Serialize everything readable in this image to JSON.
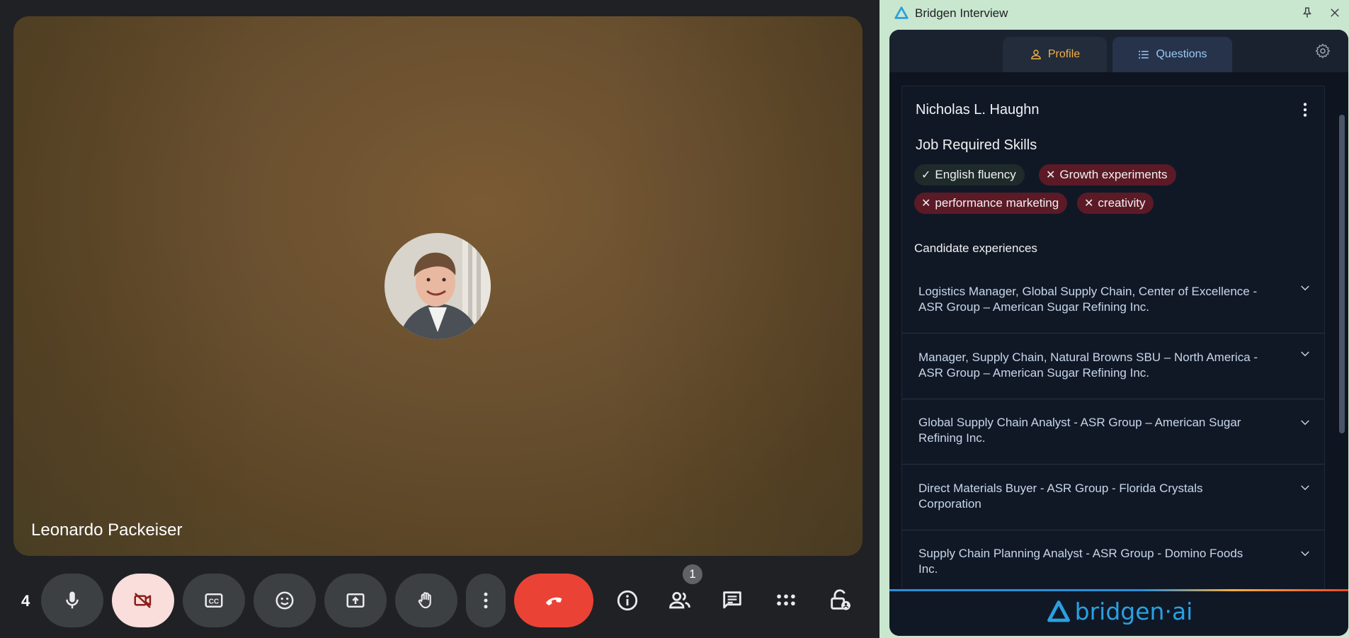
{
  "meeting": {
    "participant_name": "Leonardo Packeiser",
    "participant_count": "4",
    "people_badge": "1",
    "colors": {
      "leave": "#ea4335",
      "camera_off": "#f9dedc"
    }
  },
  "toolbar": {
    "icons": [
      "mic-icon",
      "camera-off-icon",
      "captions-icon",
      "emoji-icon",
      "present-icon",
      "raise-hand-icon",
      "more-options-icon",
      "end-call-icon",
      "info-icon",
      "people-icon",
      "chat-icon",
      "activities-icon",
      "host-controls-icon"
    ]
  },
  "panel": {
    "title": "Bridgen Interview",
    "tabs": [
      {
        "label": "Profile",
        "active": true
      },
      {
        "label": "Questions",
        "active": false
      }
    ],
    "candidate_name": "Nicholas L. Haughn",
    "skills_title": "Job Required Skills",
    "skills": [
      {
        "label": "English fluency",
        "matched": true
      },
      {
        "label": "Growth experiments",
        "matched": false
      },
      {
        "label": "performance marketing",
        "matched": false
      },
      {
        "label": "creativity",
        "matched": false
      }
    ],
    "experiences_title": "Candidate experiences",
    "experiences": [
      {
        "line1": "Logistics Manager, Global Supply Chain, Center of Excellence -",
        "line2": "ASR Group – American Sugar Refining Inc."
      },
      {
        "line1": "Manager, Supply Chain, Natural Browns SBU – North America -",
        "line2": "ASR Group – American Sugar Refining Inc."
      },
      {
        "line1": "Global Supply Chain Analyst - ASR Group – American Sugar",
        "line2": "Refining Inc."
      },
      {
        "line1": "Direct Materials Buyer - ASR Group - Florida Crystals",
        "line2": "Corporation"
      },
      {
        "line1": "Supply Chain Planning Analyst - ASR Group - Domino Foods",
        "line2": "Inc."
      }
    ],
    "brand": "bridgen·ai",
    "colors": {
      "accent": "#f5b043",
      "brand": "#2aa0e0",
      "skill_missing": "#5b1a26"
    }
  }
}
